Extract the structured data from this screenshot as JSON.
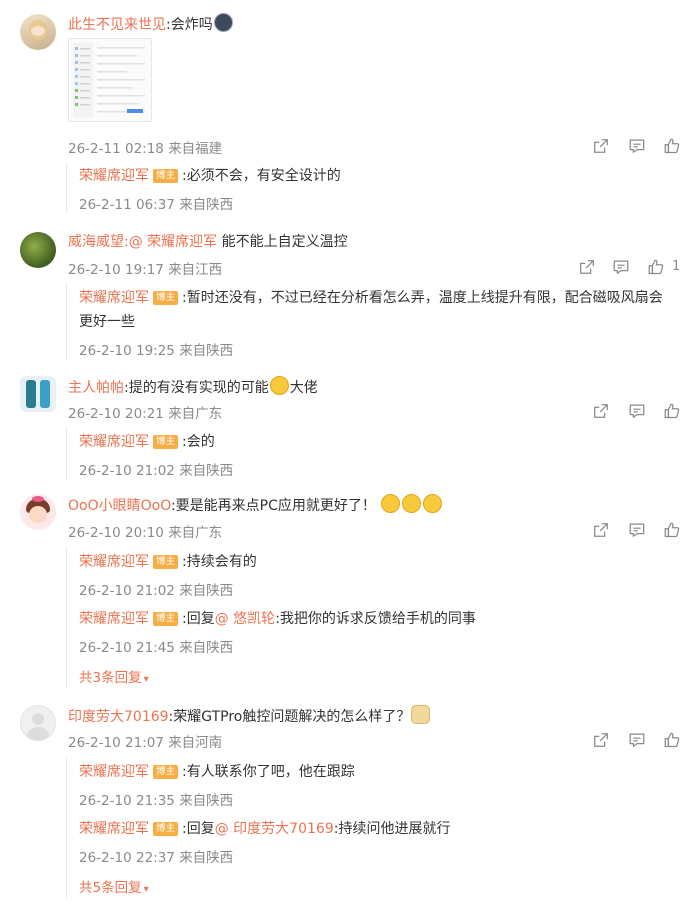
{
  "comments": [
    {
      "user": "此生不见来世见",
      "text": ":会炸吗",
      "time": "26-2-11 02:18",
      "location": "来自福建",
      "has_image": true,
      "replies": [
        {
          "user": "荣耀席迎军",
          "badge": "博主",
          "text": ":必须不会，有安全设计的",
          "time": "26-2-11 06:37",
          "location": "来自陕西"
        }
      ]
    },
    {
      "user": "威海威望",
      "mention": ":@ 荣耀席迎军",
      "text": " 能不能上自定义温控",
      "time": "26-2-10 19:17",
      "location": "来自江西",
      "likes": "1",
      "replies": [
        {
          "user": "荣耀席迎军",
          "badge": "博主",
          "text": ":暂时还没有，不过已经在分析看怎么弄，温度上线提升有限，配合磁吸风扇会",
          "text2": "更好一些",
          "time": "26-2-10 19:25",
          "location": "来自陕西"
        }
      ]
    },
    {
      "user": "主人帕帕",
      "text": ":提的有没有实现的可能",
      "text_after": "大佬",
      "time": "26-2-10 20:21",
      "location": "来自广东",
      "replies": [
        {
          "user": "荣耀席迎军",
          "badge": "博主",
          "text": ":会的",
          "time": "26-2-10 21:02",
          "location": "来自陕西"
        }
      ]
    },
    {
      "user": "OoO小眼睛OoO",
      "text": ":要是能再来点PC应用就更好了！",
      "time": "26-2-10 20:10",
      "location": "来自广东",
      "replies": [
        {
          "user": "荣耀席迎军",
          "badge": "博主",
          "text": ":持续会有的",
          "time": "26-2-10 21:02",
          "location": "来自陕西"
        },
        {
          "user": "荣耀席迎军",
          "badge": "博主",
          "prefix": ":回复",
          "mention": "@ 悠凯轮",
          "text": ":我把你的诉求反馈给手机的同事",
          "time": "26-2-10 21:45",
          "location": "来自陕西"
        }
      ],
      "more": "共3条回复"
    },
    {
      "user": "印度劳大70169",
      "text": ":荣耀GTPro触控问题解决的怎么样了？",
      "time": "26-2-10 21:07",
      "location": "来自河南",
      "replies": [
        {
          "user": "荣耀席迎军",
          "badge": "博主",
          "text": ":有人联系你了吧，他在跟踪",
          "time": "26-2-10 21:35",
          "location": "来自陕西"
        },
        {
          "user": "荣耀席迎军",
          "badge": "博主",
          "prefix": ":回复",
          "mention": "@ 印度劳大70169",
          "text": ":持续问他进展就行",
          "time": "26-2-10 22:37",
          "location": "来自陕西"
        }
      ],
      "more": "共5条回复"
    }
  ],
  "icons": [
    "share-icon",
    "comment-icon",
    "like-icon"
  ],
  "colors": {
    "username": "#eb7350",
    "meta": "#8a8a8a",
    "badge": "#f7ae45"
  }
}
